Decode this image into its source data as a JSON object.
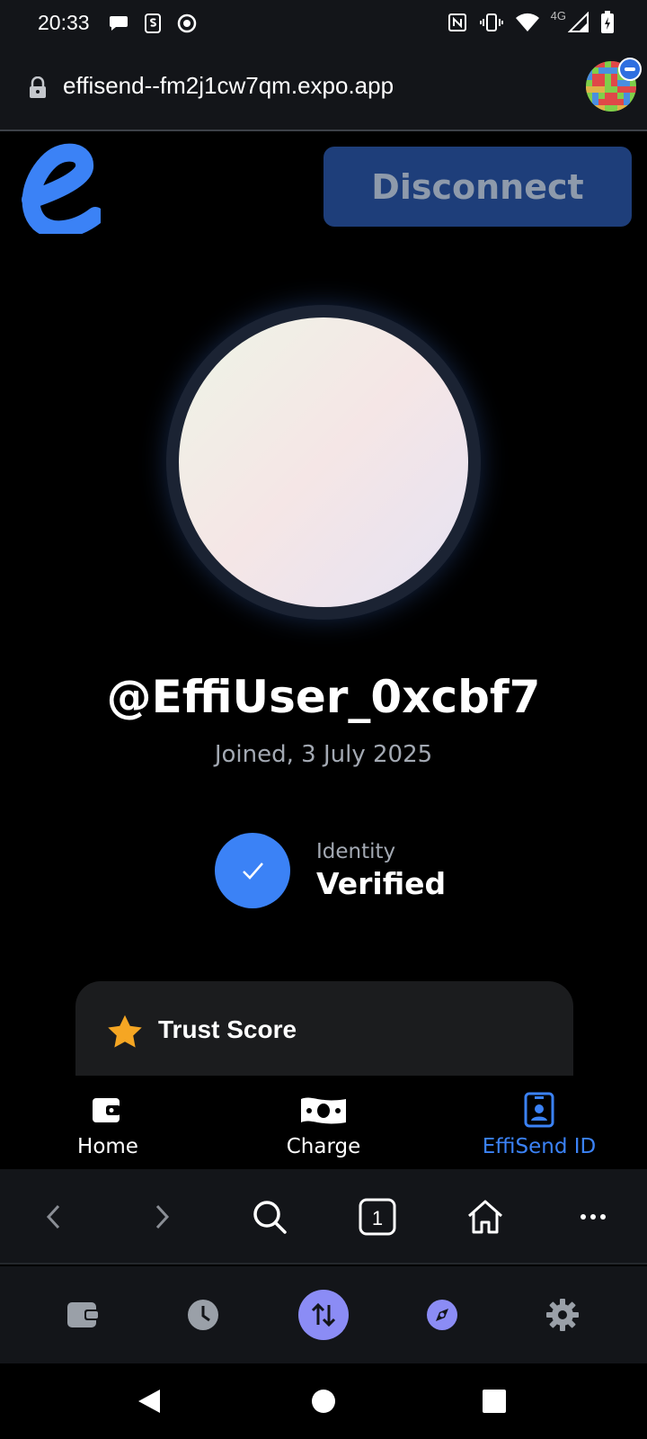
{
  "status_bar": {
    "time": "20:33",
    "network": "4G",
    "icons": [
      "chat-bubble-icon",
      "s-app-icon",
      "record-icon",
      "nfc-icon",
      "vibrate-icon",
      "wifi-icon",
      "signal-icon",
      "battery-charging-icon"
    ]
  },
  "browser": {
    "url": "effisend--fm2j1cw7qm.expo.app",
    "tab_count": "1"
  },
  "app": {
    "logo_letter": "e",
    "disconnect_label": "Disconnect",
    "username": "@EffiUser_0xcbf7",
    "joined": "Joined, 3 July 2025",
    "identity_label": "Identity",
    "identity_status": "Verified",
    "trust_title": "Trust Score",
    "tabs": [
      {
        "label": "Home",
        "icon": "wallet-icon"
      },
      {
        "label": "Charge",
        "icon": "cash-icon"
      },
      {
        "label": "EffiSend ID",
        "icon": "id-badge-icon",
        "active": true
      }
    ]
  },
  "colors": {
    "accent": "#3b82f6",
    "disconnect_bg": "#1e3e7a",
    "wallet_bar_active": "#8b8cf5",
    "star": "#f5a623"
  }
}
